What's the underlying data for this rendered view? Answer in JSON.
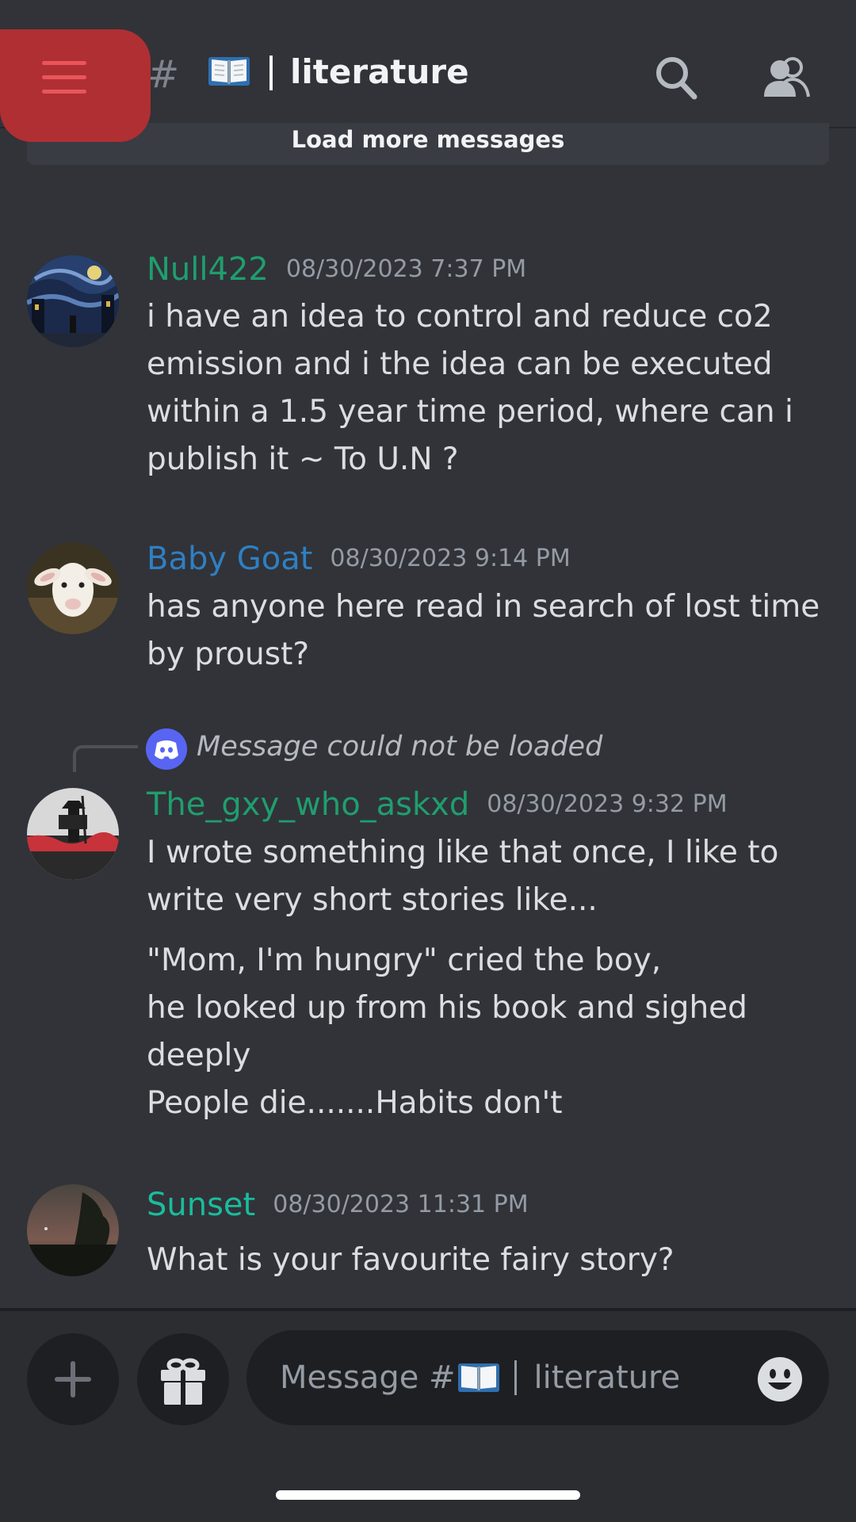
{
  "header": {
    "menu_icon": "hamburger-menu-icon",
    "hash": "#",
    "channel_emoji": "📖",
    "channel_name": "literature",
    "search_icon": "search-icon",
    "members_icon": "members-icon"
  },
  "load_more_label": "Load more messages",
  "messages": [
    {
      "author": "Null422",
      "author_color": "#1f9e6e",
      "timestamp": "08/30/2023 7:37 PM",
      "text": "i have an idea to control and reduce co2 emission and i the idea can be executed within a 1.5 year time period, where can i publish it ~ To U.N ?"
    },
    {
      "author": "Baby Goat",
      "author_color": "#2f7fc3",
      "timestamp": "08/30/2023 9:14 PM",
      "text": "has anyone here read in search of lost time by proust?"
    },
    {
      "reply_preview": "Message could not be loaded",
      "author": "The_gxy_who_askxd",
      "author_color": "#1f9e6e",
      "timestamp": "08/30/2023 9:32 PM",
      "text": "I wrote something like that once, I like to write very short stories like...",
      "text2": "\"Mom, I'm hungry\" cried the boy,\nhe looked up from his book and sighed deeply\nPeople die.......Habits don't"
    },
    {
      "author": "Sunset",
      "author_color": "#1abc9c",
      "timestamp": "08/30/2023 11:31 PM",
      "text": "What is your favourite fairy story?"
    }
  ],
  "composer": {
    "plus_icon": "plus-icon",
    "gift_icon": "gift-icon",
    "placeholder_prefix": "Message #",
    "placeholder_emoji": "📖",
    "placeholder_channel": "literature",
    "emoji_icon": "emoji-icon"
  }
}
